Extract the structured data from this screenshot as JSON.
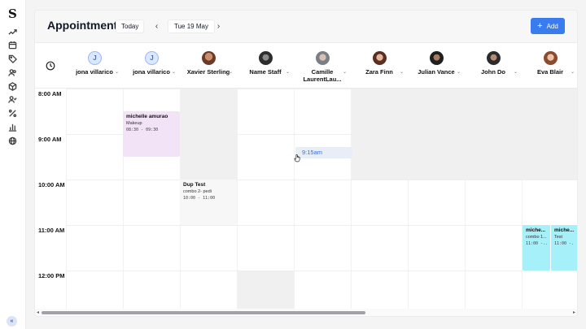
{
  "rail": {
    "logo": "S",
    "icons": [
      "trend-icon",
      "calendar-icon",
      "tag-icon",
      "users-icon",
      "box-icon",
      "user-check-icon",
      "percent-icon",
      "bar-chart-icon",
      "globe-icon"
    ],
    "collapse_label": "«"
  },
  "header": {
    "title": "Appointments",
    "today_label": "Today",
    "prev_label": "‹",
    "next_label": "›",
    "date_label": "Tue 19 May",
    "add_label": "Add",
    "add_plus": "+"
  },
  "staff": [
    {
      "name": "jona villarico",
      "initial": "J"
    },
    {
      "name": "jona villarico",
      "initial": "J"
    },
    {
      "name": "Xavier Sterling",
      "initial": ""
    },
    {
      "name": "Name Staff",
      "initial": ""
    },
    {
      "name": "Camille LaurentLau...",
      "initial": ""
    },
    {
      "name": "Zara Finn",
      "initial": ""
    },
    {
      "name": "Julian Vance",
      "initial": ""
    },
    {
      "name": "John Do",
      "initial": ""
    },
    {
      "name": "Eva Blair",
      "initial": ""
    }
  ],
  "times": [
    "8:00 AM",
    "9:00 AM",
    "10:00 AM",
    "11:00 AM",
    "12:00 PM"
  ],
  "appointments": {
    "a1": {
      "name": "michelle amurao",
      "service": "Makeup",
      "time": "08:30 - 09:30",
      "color": "#f3e3f7"
    },
    "a2": {
      "name": "Dup Test",
      "service": "combo 2- pedi",
      "time": "10:00 - 11:00",
      "color": "#f7f7f8"
    },
    "a3": {
      "name": "miche...",
      "service": "combo 1...",
      "time": "11:00 -...",
      "color": "#a5f0f9"
    },
    "a4": {
      "name": "miche...",
      "service": "Test",
      "time": "11:00 -...",
      "color": "#a5f0f9"
    }
  },
  "hover_slot": "9:15am",
  "scroll": {
    "left": "◂",
    "right": "▸"
  }
}
